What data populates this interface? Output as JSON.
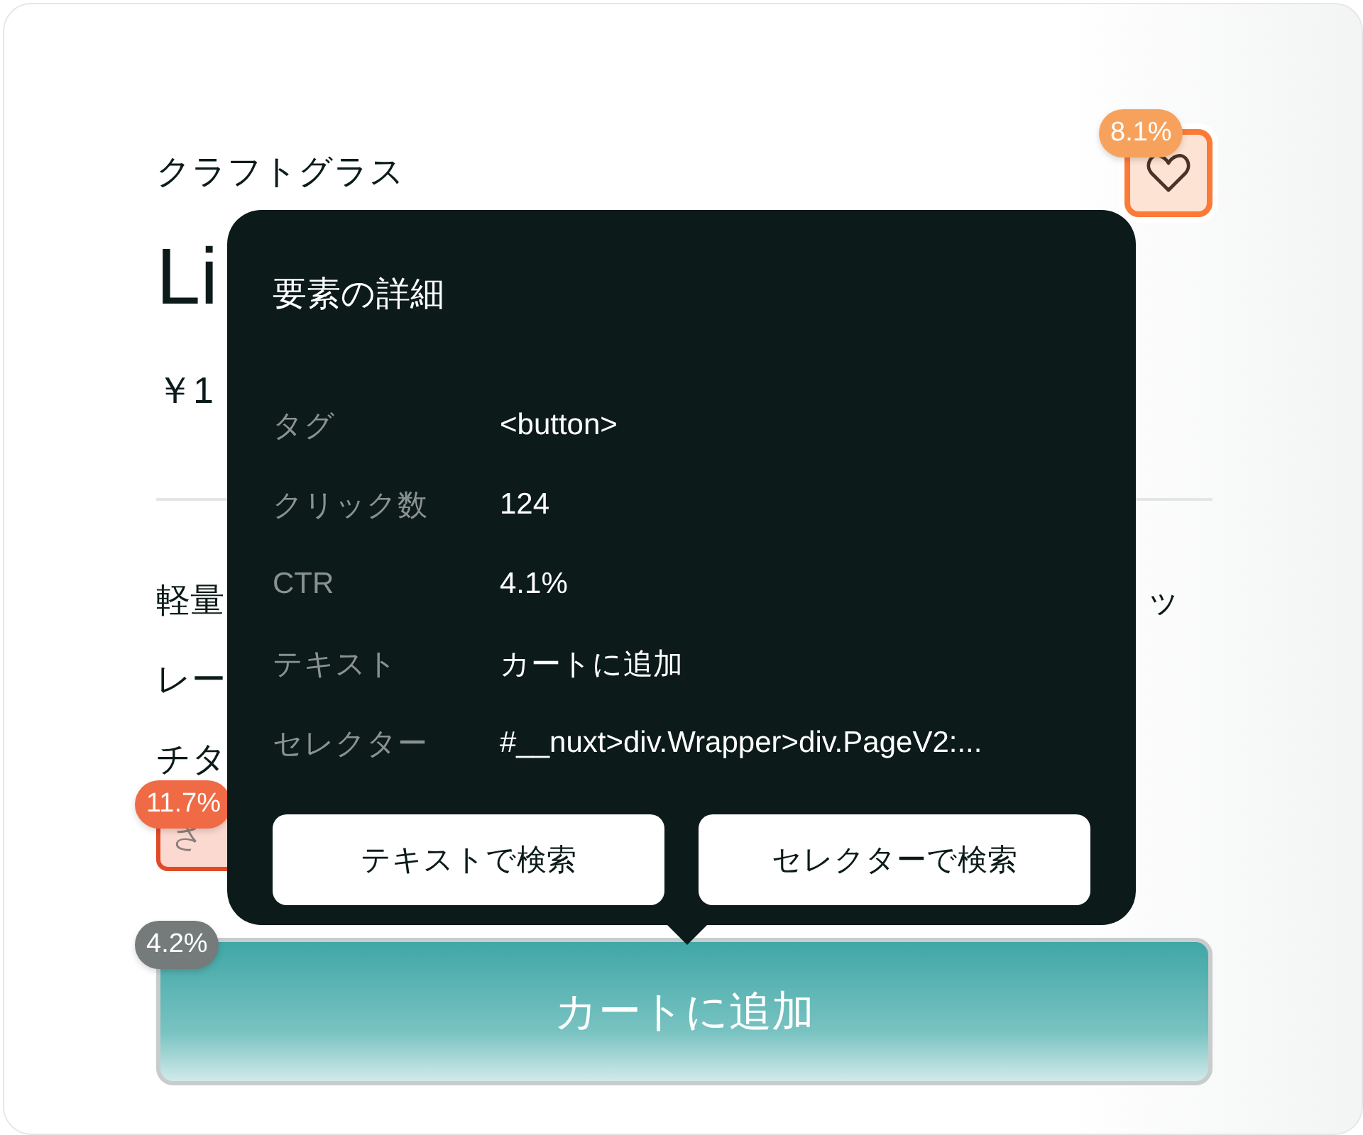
{
  "product": {
    "category": "クラフトグラス",
    "title": "Li",
    "price": "￥1",
    "description_lines": [
      "軽量",
      "レー",
      "チタ"
    ],
    "description_tail": "ッ",
    "more_button": {
      "label": "さ",
      "badge": {
        "text": "11.7%",
        "color": "#ef6a45"
      }
    },
    "favorite_button": {
      "badge": {
        "text": "8.1%",
        "color": "#f7a25c"
      }
    },
    "cart_button": {
      "label": "カートに追加",
      "badge": {
        "text": "4.2%",
        "color": "#757a7a"
      }
    }
  },
  "tooltip": {
    "title": "要素の詳細",
    "rows": [
      {
        "label": "タグ",
        "value": "<button>"
      },
      {
        "label": "クリック数",
        "value": "124"
      },
      {
        "label": "CTR",
        "value": "4.1%"
      },
      {
        "label": "テキスト",
        "value": "カートに追加"
      },
      {
        "label": "セレクター",
        "value": "#__nuxt>div.Wrapper>div.PageV2:..."
      }
    ],
    "buttons": [
      "テキストで検索",
      "セレクターで検索"
    ]
  }
}
